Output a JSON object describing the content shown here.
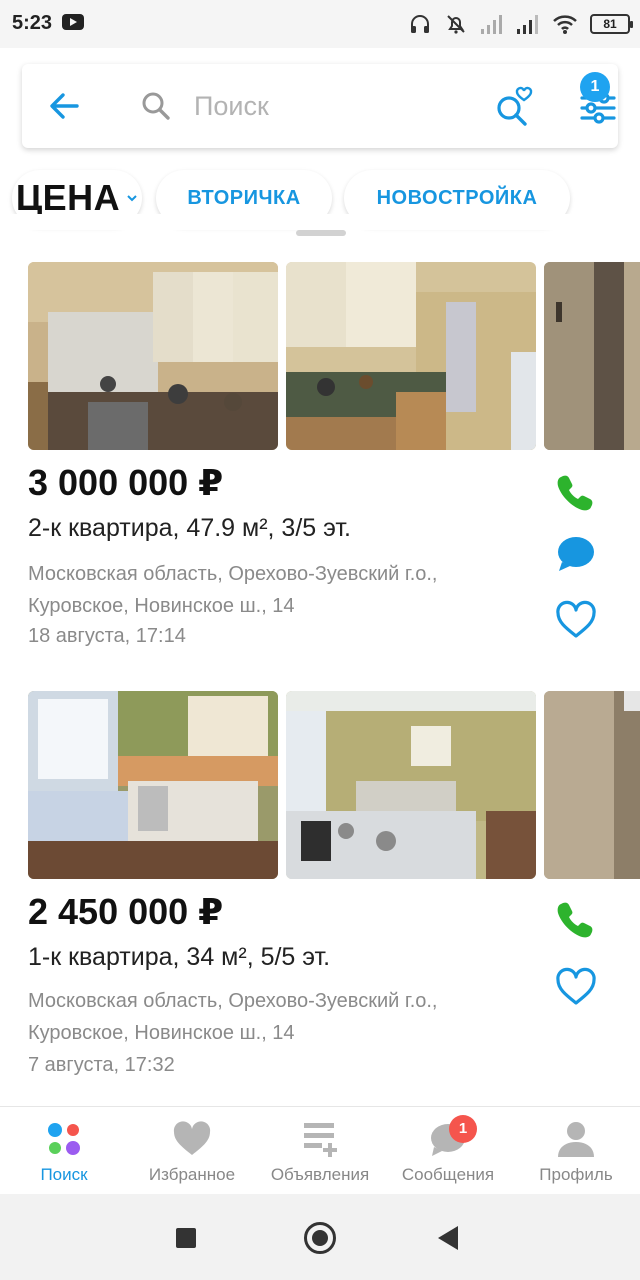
{
  "status_bar": {
    "time": "5:23",
    "battery": "81"
  },
  "search": {
    "placeholder": "Поиск",
    "filter_badge": "1"
  },
  "chips": {
    "price": "ЦЕНА",
    "secondary": "ВТОРИЧКА",
    "newbuild": "НОВОСТРОЙКА"
  },
  "colors": {
    "accent": "#1796e0",
    "call_green": "#2db32d",
    "badge_red": "#f5554d"
  },
  "listings": [
    {
      "price": "3 000 000 ₽",
      "title": "2-к квартира, 47.9 м², 3/5 эт.",
      "address": "Московская область, Орехово-Зуевский г.о., Куровское, Новинское ш., 14",
      "date": "18 августа, 17:14",
      "actions": [
        "phone-icon",
        "chat-icon",
        "heart-icon"
      ]
    },
    {
      "price": "2 450 000 ₽",
      "title": "1-к квартира, 34 м², 5/5 эт.",
      "address": "Московская область, Орехово-Зуевский г.о., Куровское, Новинское ш., 14",
      "date": "7 августа, 17:32",
      "actions": [
        "phone-icon",
        "heart-icon"
      ]
    }
  ],
  "bottom_nav": {
    "items": [
      {
        "label": "Поиск",
        "icon": "search-dots-icon",
        "active": true
      },
      {
        "label": "Избранное",
        "icon": "heart-icon"
      },
      {
        "label": "Объявления",
        "icon": "add-listing-icon"
      },
      {
        "label": "Сообщения",
        "icon": "chat-icon",
        "badge": "1"
      },
      {
        "label": "Профиль",
        "icon": "profile-icon"
      }
    ]
  }
}
